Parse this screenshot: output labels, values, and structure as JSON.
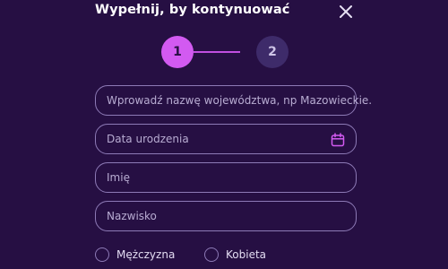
{
  "header": {
    "title": "Wypełnij, by kontynuować",
    "close_icon": "close-icon"
  },
  "stepper": {
    "steps": [
      {
        "label": "1",
        "state": "active"
      },
      {
        "label": "2",
        "state": "inactive"
      }
    ],
    "active_color": "#d25af1",
    "inactive_color": "#3e2b6a"
  },
  "form": {
    "region_placeholder": "Wprowadź nazwę województwa, np Mazowieckie.",
    "birthdate_placeholder": "Data urodzenia",
    "birthdate_icon": "calendar-icon",
    "first_name_placeholder": "Imię",
    "last_name_placeholder": "Nazwisko",
    "gender_options": [
      "Mężczyzna",
      "Kobieta"
    ]
  },
  "colors": {
    "background": "#260f43",
    "accent": "#d25af1",
    "field_border": "#8d7ab6"
  }
}
